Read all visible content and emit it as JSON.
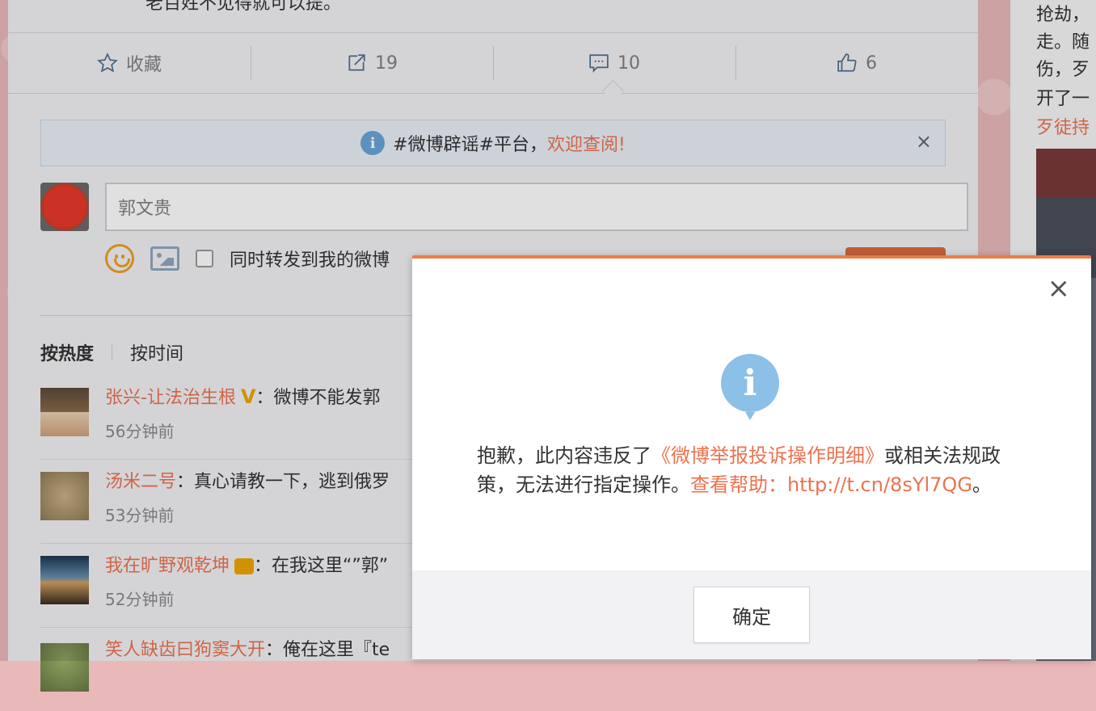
{
  "feed": {
    "top_text": "老百姓不见得就可以提。",
    "actions": {
      "favorite": "收藏",
      "repost_count": "19",
      "comment_count": "10",
      "like_count": "6"
    }
  },
  "notice": {
    "text": "#微博辟谣#平台，",
    "highlight": "欢迎查阅!",
    "close": "×"
  },
  "composer": {
    "input_value": "郭文贵",
    "checkbox_label": "同时转发到我的微博"
  },
  "sort": {
    "hot": "按热度",
    "time": "按时间"
  },
  "comments": [
    {
      "user": "张兴-让法治生根",
      "badge": "V",
      "text": "：微博不能发郭",
      "time": "56分钟前"
    },
    {
      "user": "汤米二号",
      "text": "：真心请教一下，逃到俄罗",
      "time": "53分钟前"
    },
    {
      "user": "我在旷野观乾坤",
      "text": "：在我这里“”郭”",
      "time": "52分钟前"
    },
    {
      "user": "笑人缺齿曰狗窦大开",
      "text": "：俺在这里『te",
      "time": ""
    }
  ],
  "sidebar": {
    "lines": [
      "抢劫，",
      "走。随",
      "伤，歹",
      "开了一",
      "歹徒持"
    ]
  },
  "dialog": {
    "close": "×",
    "icon": "i",
    "msg_part1": "抱歉，此内容违反了",
    "msg_link1": "《微博举报投诉操作明细》",
    "msg_part2": "或相关法规政策，无法进行指定操作。",
    "msg_link2": "查看帮助：http://t.cn/8sYl7QG",
    "msg_end": "。",
    "ok_label": "确定"
  }
}
